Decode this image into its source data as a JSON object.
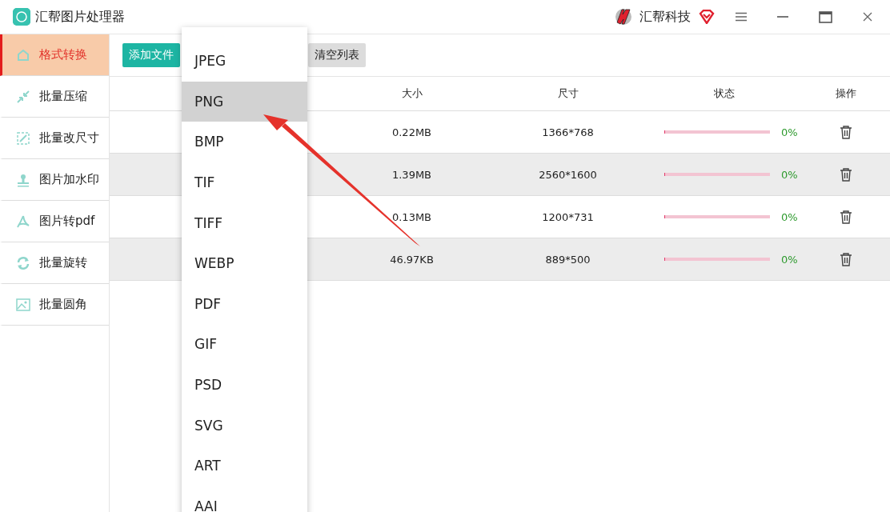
{
  "window": {
    "title": "汇帮图片处理器",
    "brand": "汇帮科技"
  },
  "sidebar": {
    "items": [
      {
        "label": "格式转换",
        "selected": true
      },
      {
        "label": "批量压缩",
        "selected": false
      },
      {
        "label": "批量改尺寸",
        "selected": false
      },
      {
        "label": "图片加水印",
        "selected": false
      },
      {
        "label": "图片转pdf",
        "selected": false
      },
      {
        "label": "批量旋转",
        "selected": false
      },
      {
        "label": "批量圆角",
        "selected": false
      }
    ]
  },
  "toolbar": {
    "buttons": [
      {
        "label": "添加文件",
        "kind": "primary"
      },
      {
        "label": "清空列表",
        "kind": "secondary"
      }
    ]
  },
  "table": {
    "columns": [
      "大小",
      "尺寸",
      "状态",
      "操作"
    ],
    "rows": [
      {
        "size": "1366*768",
        "file_size": "0.22MB",
        "level": 0,
        "percent": "0%"
      },
      {
        "size": "2560*1600",
        "file_size": "1.39MB",
        "level": 0,
        "percent": "0%"
      },
      {
        "size": "1200*731",
        "file_size": "0.13MB",
        "level": 0,
        "percent": "0%"
      },
      {
        "size": "889*500",
        "file_size": "46.97KB",
        "level": 0,
        "percent": "0%"
      }
    ]
  },
  "format_menu": {
    "items": [
      {
        "label": "JPEG",
        "selected": false
      },
      {
        "label": "PNG",
        "selected": true
      },
      {
        "label": "BMP",
        "selected": false
      },
      {
        "label": "TIF",
        "selected": false
      },
      {
        "label": "TIFF",
        "selected": false
      },
      {
        "label": "WEBP",
        "selected": false
      },
      {
        "label": "PDF",
        "selected": false
      },
      {
        "label": "GIF",
        "selected": false
      },
      {
        "label": "PSD",
        "selected": false
      },
      {
        "label": "SVG",
        "selected": false
      },
      {
        "label": "ART",
        "selected": false
      },
      {
        "label": "AAI",
        "selected": false
      }
    ]
  }
}
